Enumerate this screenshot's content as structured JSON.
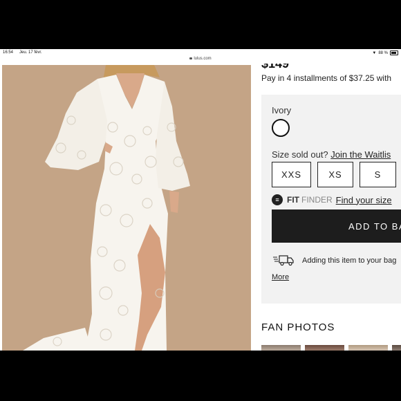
{
  "status_bar": {
    "time": "16:54",
    "date": "Jeu. 17 févr.",
    "battery": "88 %"
  },
  "browser": {
    "url": "lulus.com"
  },
  "product": {
    "price": "$149",
    "installments": "Pay in 4 installments of $37.25 with"
  },
  "options": {
    "color_name": "Ivory",
    "size_message": "Size sold out?",
    "waitlist_link": "Join the Waitlis",
    "sizes": [
      "XXS",
      "XS",
      "S"
    ],
    "fit_brand_bold": "FIT",
    "fit_brand_light": "FINDER",
    "find_size_link": "Find your size",
    "add_button": "ADD TO BA",
    "shipping_text": "Adding this item to your bag",
    "more_link": "More"
  },
  "fan_photos": {
    "title": "FAN PHOTOS"
  },
  "colors": {
    "photo_background": "#c9a98a",
    "dress": "#f7f4ee",
    "button_dark": "#1d1d1d",
    "panel_bg": "#f2f2f2"
  }
}
